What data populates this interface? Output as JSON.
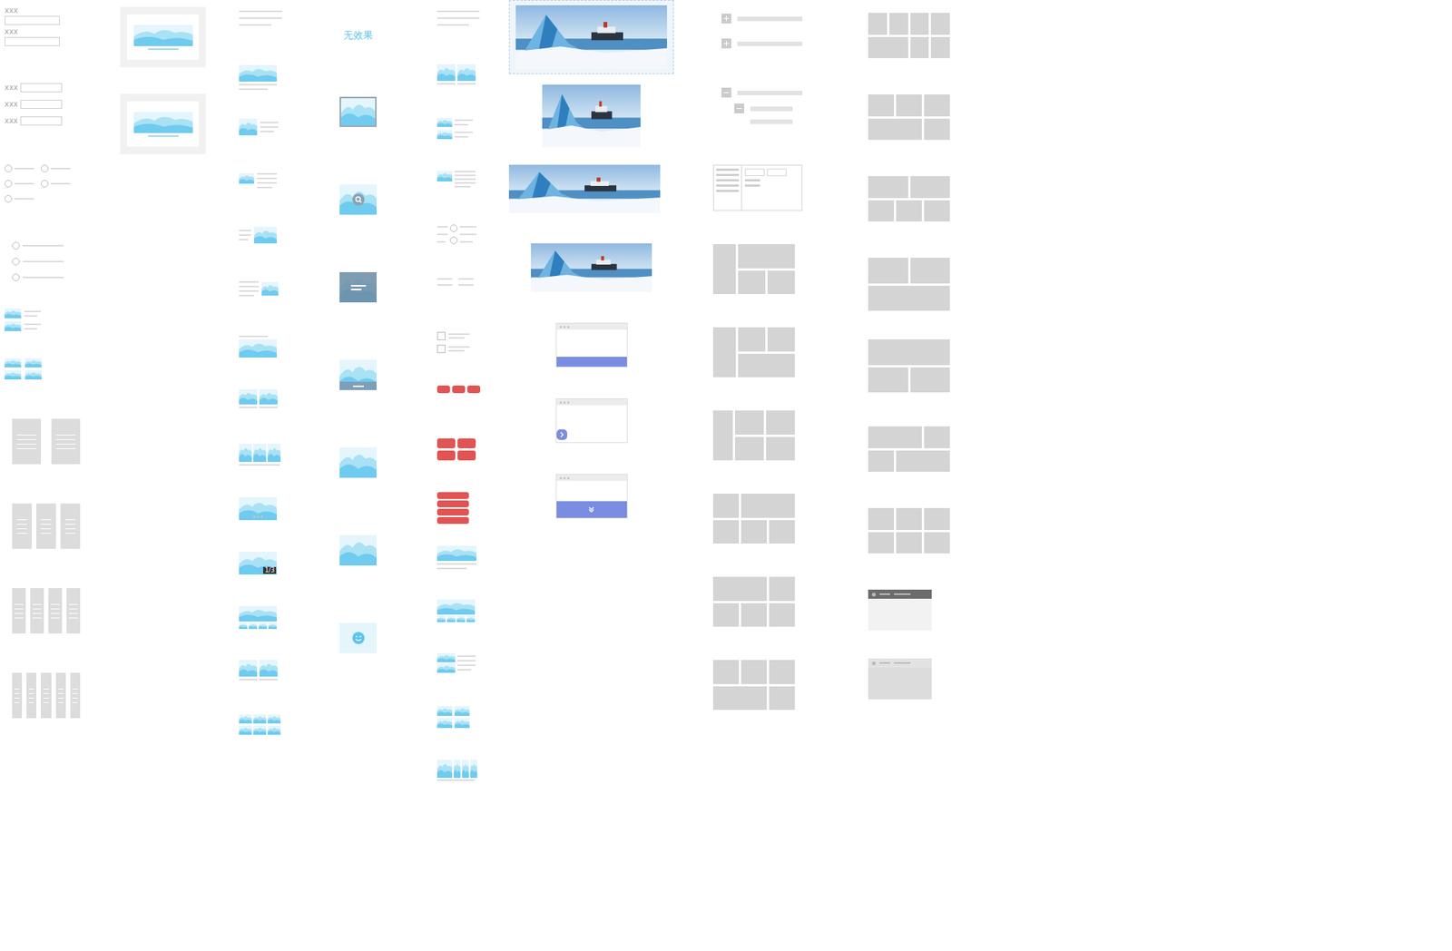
{
  "form_stacked": {
    "fields": [
      {
        "label": "xxx"
      },
      {
        "label": "xxx"
      }
    ]
  },
  "form_inline": {
    "fields": [
      {
        "label": "xxx"
      },
      {
        "label": "xxx"
      },
      {
        "label": "xxx"
      }
    ]
  },
  "radio_grid": [
    {
      "selected": false
    },
    {
      "selected": false
    },
    {
      "selected": false
    },
    {
      "selected": false
    },
    {
      "selected": false
    }
  ],
  "radio_list": [
    {
      "selected": false
    },
    {
      "selected": false
    },
    {
      "selected": false
    }
  ],
  "hover_effects": {
    "none_label": "无效果"
  },
  "slideshow_counter": "1/3",
  "checkbox_list": [
    {
      "checked": false
    },
    {
      "checked": false
    }
  ],
  "tree_collapsed": [
    {
      "expanded": false
    },
    {
      "expanded": false
    }
  ],
  "tree_expanded": [
    {
      "expanded": true,
      "children": [
        {
          "expanded": true
        }
      ]
    }
  ]
}
